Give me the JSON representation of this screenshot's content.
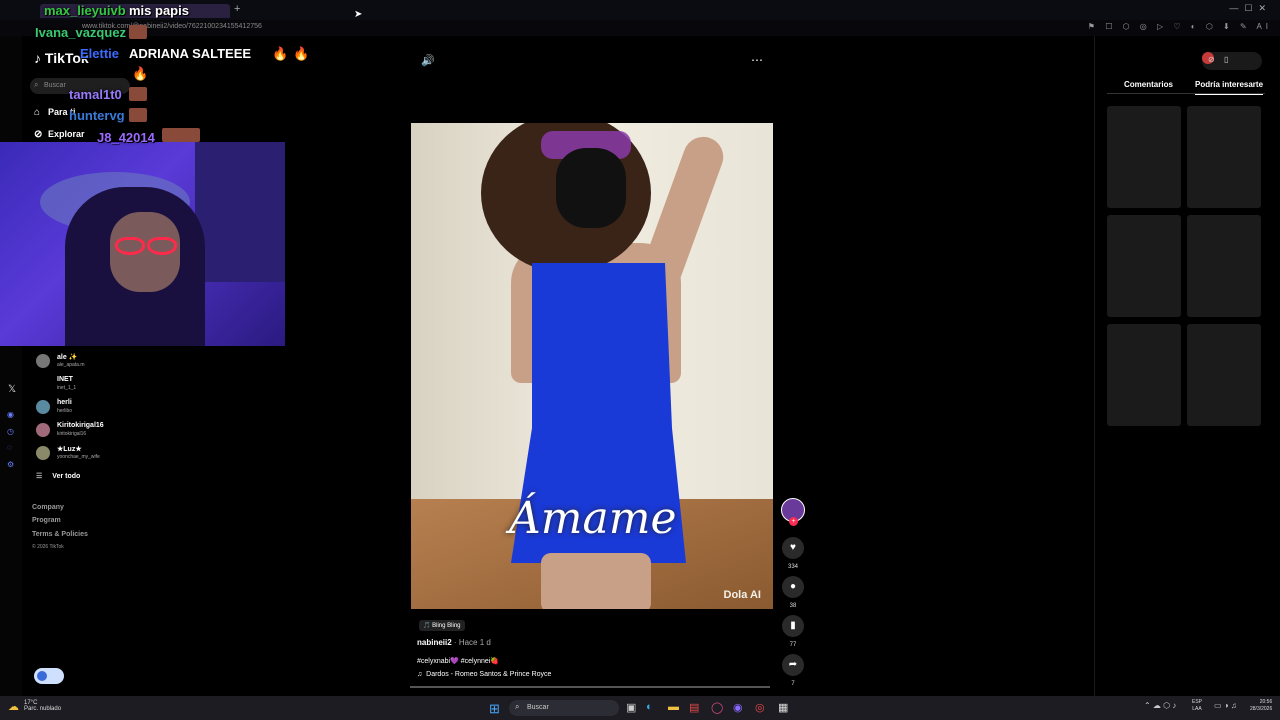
{
  "browser": {
    "tab_title": "mis papis",
    "url": "www.tiktok.com/@nabineii2/video/7622100234155412756",
    "new_tab": "+"
  },
  "tiktok": {
    "logo": "TikTok",
    "search_placeholder": "Buscar",
    "nav": [
      {
        "label": "Para ti",
        "icon": "home-icon"
      },
      {
        "label": "Explorar",
        "icon": "compass-icon"
      }
    ],
    "following": [
      {
        "name": "ale ✨",
        "handle": "ale_apata.m"
      },
      {
        "name": "INET",
        "handle": "inet_1_1"
      },
      {
        "name": "herli",
        "handle": "herlibo"
      },
      {
        "name": "Kiritokirigal16",
        "handle": "kiritokirigal16"
      },
      {
        "name": "★Luz★",
        "handle": "yoonchae_my_wife"
      }
    ],
    "see_all": "Ver todo",
    "footer": [
      "Company",
      "Program",
      "Terms & Policies"
    ],
    "copyright": "© 2026 TikTok"
  },
  "chat": [
    {
      "user": "max_lieyuivb",
      "msg": "",
      "color": "#35c845"
    },
    {
      "user": "Ivana_vazquez",
      "msg": "",
      "color": "#3ac870"
    },
    {
      "user": "Elettie",
      "msg": "ADRIANA SALTEEE",
      "color": "#3a6aff"
    },
    {
      "user": "tamal1t0",
      "msg": "",
      "color": "#9a7aff"
    },
    {
      "user": "huntervg",
      "msg": "",
      "color": "#3a7ad8"
    },
    {
      "user": "J8_42014",
      "msg": "",
      "color": "#9a6aff"
    }
  ],
  "video": {
    "overlay_text": "Ámame",
    "watermark": "Dola AI",
    "music_tag": "Bling Bling",
    "author": "nabineii2",
    "posted": "Hace 1 d",
    "hashtags": "#celyxnabi💜 #celynnei🍓",
    "song": "Dardos - Romeo Santos & Prince Royce"
  },
  "actions": {
    "likes": "334",
    "comments": "38",
    "saves": "77",
    "shares": "7"
  },
  "right_panel": {
    "tabs": [
      "Comentarios",
      "Podría interesarte"
    ],
    "active_tab": 1
  },
  "taskbar": {
    "temperature": "17°C",
    "weather": "Parc. nublado",
    "search": "Buscar",
    "lang_top": "ESP",
    "lang_bottom": "LAA",
    "time": "20:56",
    "date": "28/3/2026"
  }
}
